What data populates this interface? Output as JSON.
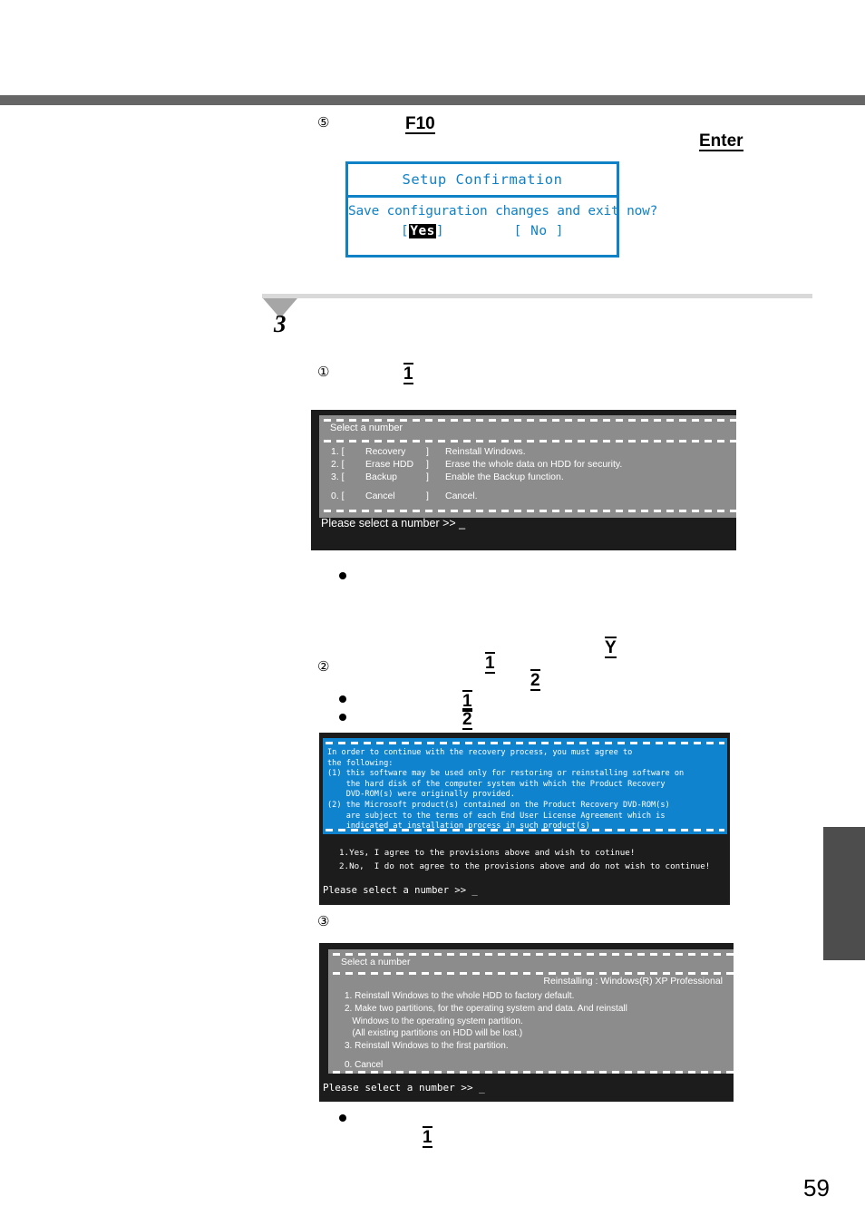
{
  "page": {
    "number": "59",
    "section_marker": "3"
  },
  "steps": {
    "circle_5": "⑤",
    "circle_1": "①",
    "circle_2": "②",
    "circle_3": "③"
  },
  "keys": {
    "f10": "F10",
    "enter": "Enter",
    "one_a": "1",
    "one_b": "1",
    "two_b": "2",
    "y": "Y",
    "one_c": "1",
    "two_c": "2",
    "one_d": "1"
  },
  "bios_dialog": {
    "title": "Setup Confirmation",
    "question": "Save configuration changes and exit now?",
    "yes_open_bracket": "[",
    "yes_label": "Yes",
    "yes_close_bracket": "]",
    "no_label": "[ No ]",
    "border_color": "#0f81c7",
    "text_color": "#0f81c7",
    "highlight_bg": "#000000",
    "highlight_fg": "#ffffff"
  },
  "screen_main_menu": {
    "header": "Select a number",
    "rows": [
      {
        "num": "1. [",
        "name": "Recovery",
        "close": "]",
        "desc": "Reinstall Windows."
      },
      {
        "num": "2. [",
        "name": "Erase HDD",
        "close": "]",
        "desc": "Erase the whole data on HDD for security."
      },
      {
        "num": "3. [",
        "name": "Backup",
        "close": "]",
        "desc": "Enable the Backup function."
      }
    ],
    "cancel_row": {
      "num": "0. [",
      "name": "Cancel",
      "close": "]",
      "desc": "Cancel."
    },
    "prompt": "Please select a number >> _",
    "panel_color": "#8c8c8c",
    "frame_color": "#1c1c1c"
  },
  "screen_license": {
    "body_lines": [
      "In order to continue with the recovery process, you must agree to",
      "the following:",
      "(1) this software may be used only for restoring or reinstalling software on",
      "    the hard disk of the computer system with which the Product Recovery",
      "    DVD-ROM(s) were originally provided.",
      "(2) the Microsoft product(s) contained on the Product Recovery DVD-ROM(s)",
      "    are subject to the terms of each End User License Agreement which is",
      "    indicated at installation process in such product(s)"
    ],
    "choices": [
      "1.Yes, I agree to the provisions above and wish to cotinue!",
      "2.No,  I do not agree to the provisions above and do not wish to continue!"
    ],
    "prompt": "Please select a number >> _",
    "panel_color": "#1083ce",
    "frame_color": "#1c1c1c"
  },
  "screen_reinstall_options": {
    "header": "Select a number",
    "subheader": "Reinstalling : Windows(R) XP Professional",
    "options": [
      "1. Reinstall Windows to the whole HDD to factory default.",
      "2. Make two partitions, for the operating system and data. And reinstall",
      "   Windows to the operating system partition.",
      "   (All existing partitions on HDD will be lost.)",
      "3. Reinstall Windows to the first partition."
    ],
    "cancel_option": "0. Cancel",
    "prompt": "Please select a number >> _",
    "panel_color": "#8c8c8c",
    "frame_color": "#1c1c1c"
  }
}
